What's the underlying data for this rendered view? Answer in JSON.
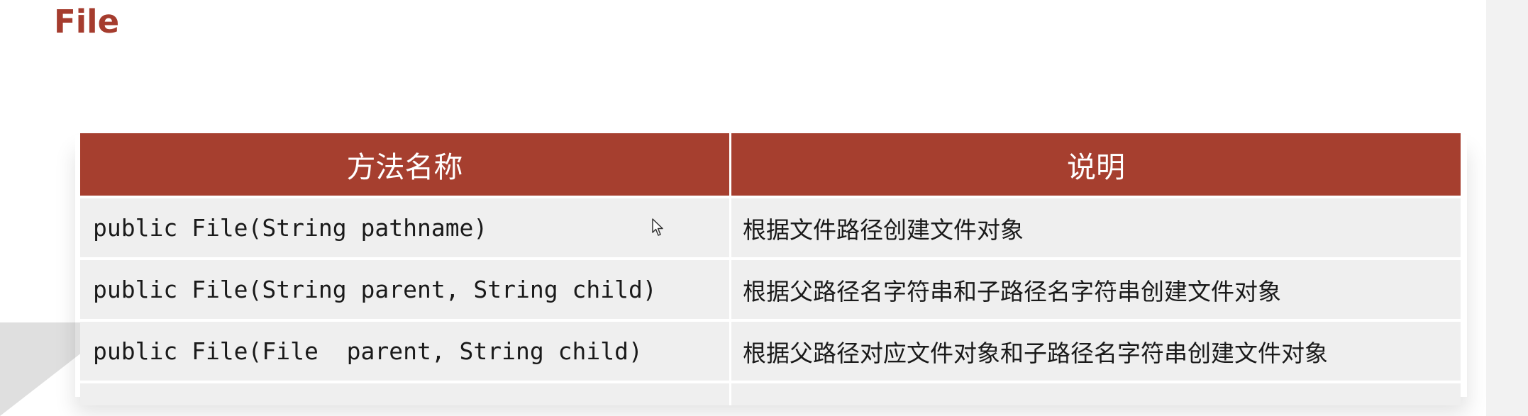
{
  "slide": {
    "title": "File"
  },
  "table": {
    "headers": [
      "方法名称",
      "说明"
    ],
    "rows": [
      {
        "method": "public File(String pathname)",
        "description": "根据文件路径创建文件对象"
      },
      {
        "method": "public File(String parent, String child)",
        "description": "根据父路径名字符串和子路径名字符串创建文件对象"
      },
      {
        "method": "public File(File  parent, String child)",
        "description": "根据父路径对应文件对象和子路径名字符串创建文件对象"
      }
    ]
  },
  "colors": {
    "title": "#a53c2e",
    "header_background": "#a63f2f",
    "row_background": "#efefef"
  },
  "icons": {
    "cursor": "mouse-pointer-icon"
  }
}
